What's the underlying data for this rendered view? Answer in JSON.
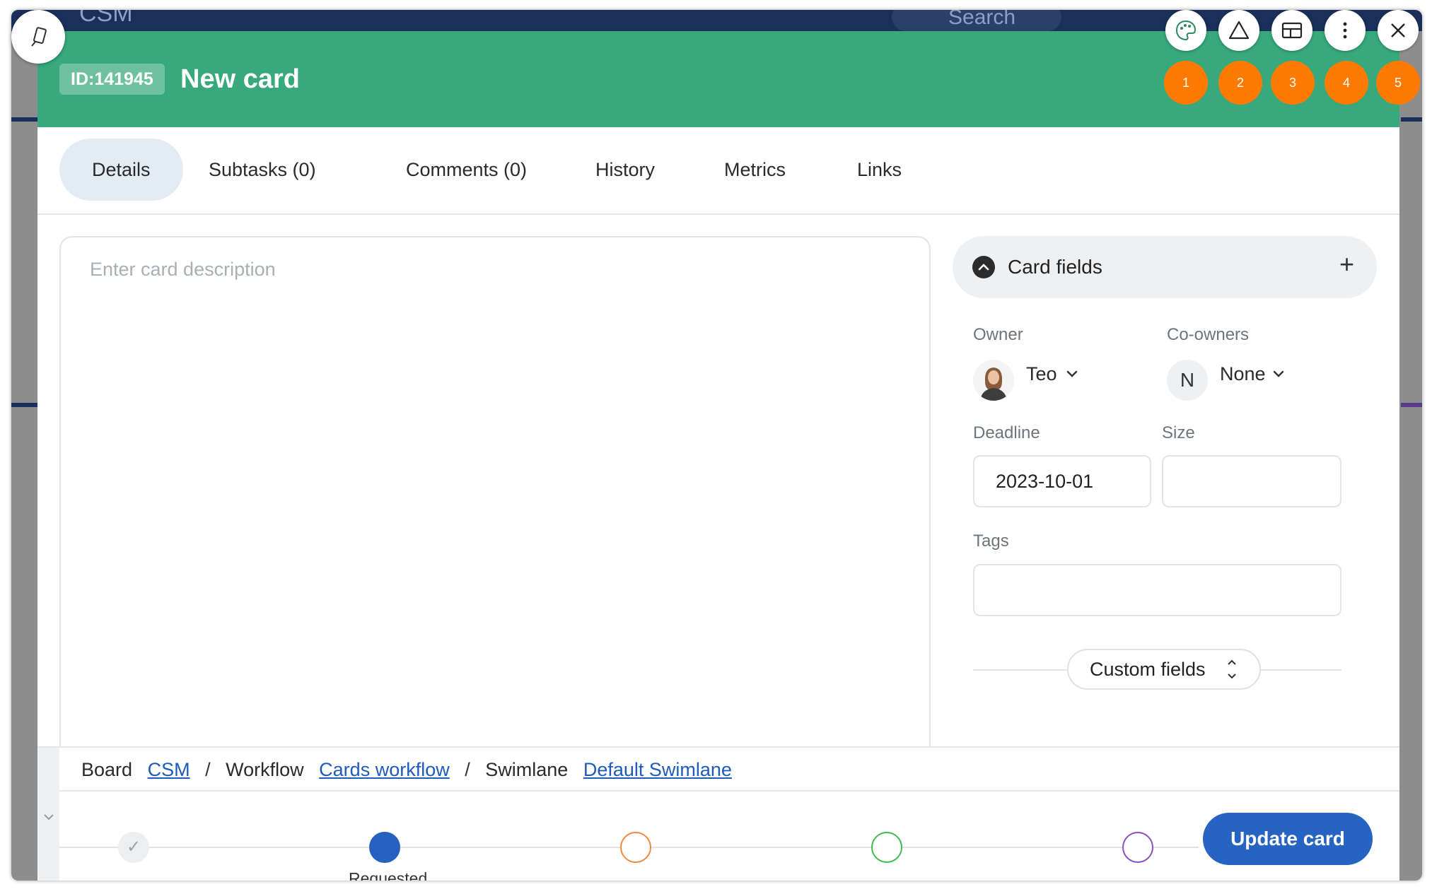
{
  "backdrop": {
    "app_label": "CSM",
    "search_placeholder": "Search"
  },
  "card": {
    "id_label": "ID:141945",
    "title": "New card",
    "header_color": "#37a97c"
  },
  "tabs": [
    {
      "label": "Details",
      "active": true
    },
    {
      "label": "Subtasks (0)"
    },
    {
      "label": "Comments (0)"
    },
    {
      "label": "History"
    },
    {
      "label": "Metrics"
    },
    {
      "label": "Links"
    }
  ],
  "description": {
    "placeholder": "Enter card description"
  },
  "fields": {
    "section_title": "Card fields",
    "owner_label": "Owner",
    "owner_name": "Teo",
    "coowners_label": "Co-owners",
    "coowners_initial": "N",
    "coowners_value": "None",
    "deadline_label": "Deadline",
    "deadline_value": "2023-10-01",
    "size_label": "Size",
    "size_value": "",
    "tags_label": "Tags",
    "custom_fields_label": "Custom fields"
  },
  "breadcrumb": {
    "board_label": "Board",
    "board_link": "CSM",
    "workflow_label": "Workflow",
    "workflow_link": "Cards workflow",
    "swimlane_label": "Swimlane",
    "swimlane_link": "Default Swimlane",
    "separator": "/"
  },
  "workflow_steps": [
    {
      "state": "done",
      "color": "#9aa1a7"
    },
    {
      "state": "current",
      "label": "Requested",
      "color": "#2561bf"
    },
    {
      "state": "todo",
      "color": "#f0883e"
    },
    {
      "state": "todo",
      "color": "#3fb950"
    },
    {
      "state": "todo",
      "color": "#8a4fc0"
    }
  ],
  "actions": {
    "update_label": "Update card"
  },
  "toolbar": {
    "icons": [
      "palette-icon",
      "warning-triangle-icon",
      "layout-icon",
      "more-vertical-icon",
      "close-icon"
    ],
    "badges": [
      "1",
      "2",
      "3",
      "4",
      "5"
    ],
    "badge_color": "#ff7a00"
  }
}
